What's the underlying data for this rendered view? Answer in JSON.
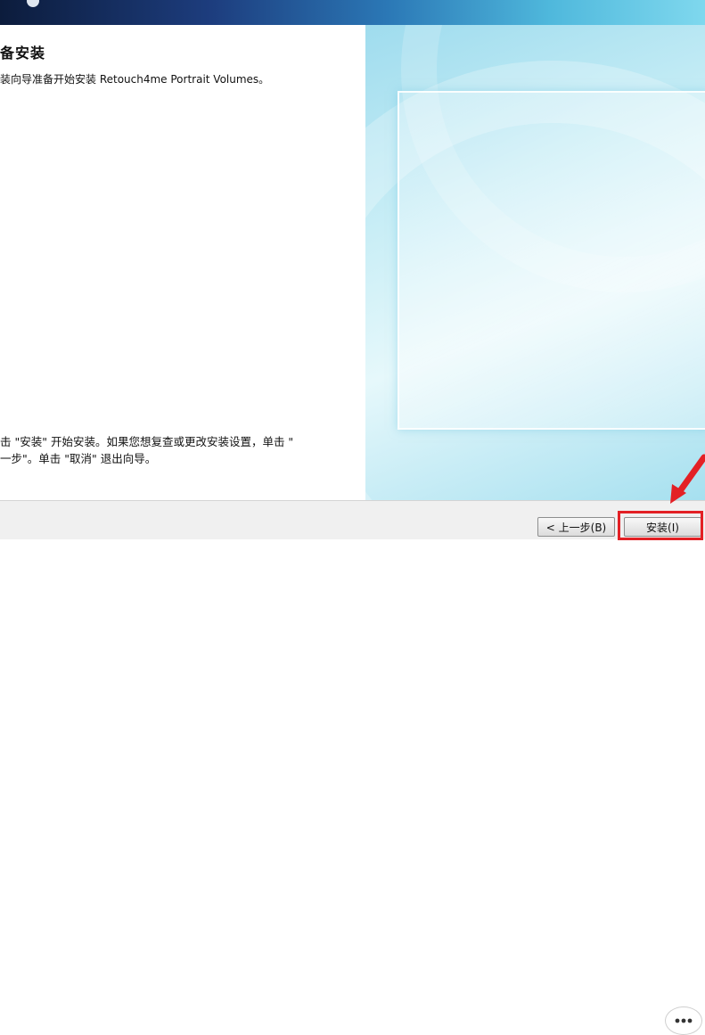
{
  "header": {
    "title": "备安装",
    "description": "装向导准备开始安装 Retouch4me Portrait Volumes。"
  },
  "instructions": {
    "line1": "击 \"安装\" 开始安装。如果您想复查或更改安装设置，单击 \"",
    "line2": "一步\"。单击 \"取消\" 退出向导。"
  },
  "buttons": {
    "back_label": "< 上一步(B)",
    "install_label": "安装(I)"
  },
  "colors": {
    "highlight": "#e32025",
    "banner_dark": "#0c1c3c",
    "panel_cyan": "#9fdcee"
  },
  "icons": {
    "annotation_arrow": "red-arrow-icon",
    "watermark": "wechat-logo-icon"
  }
}
